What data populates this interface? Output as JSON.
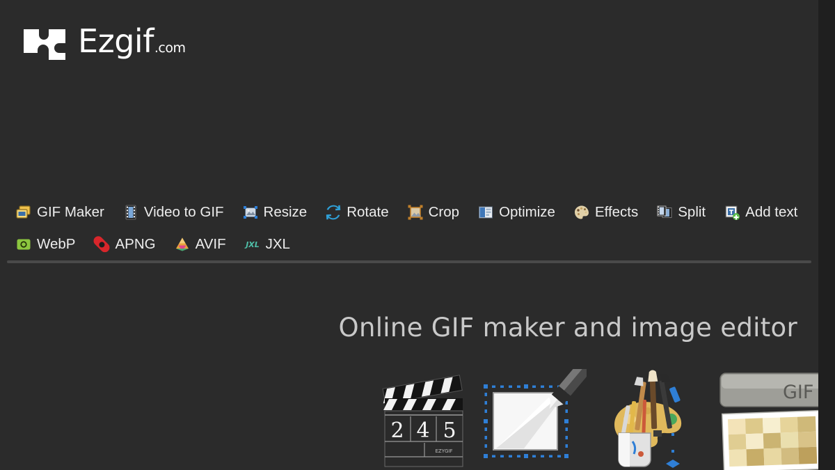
{
  "site": {
    "logo_text": "Ezgif",
    "logo_tld": ".com",
    "logo_icon": "ezgif-puzzle-logo-icon",
    "background_color": "#2b2b2b",
    "gutter_color": "#1f1f1f"
  },
  "nav": {
    "rows": [
      [
        {
          "label": "GIF Maker",
          "icon": "gif-maker-icon"
        },
        {
          "label": "Video to GIF",
          "icon": "video-to-gif-icon"
        },
        {
          "label": "Resize",
          "icon": "resize-icon"
        },
        {
          "label": "Rotate",
          "icon": "rotate-icon"
        },
        {
          "label": "Crop",
          "icon": "crop-icon"
        },
        {
          "label": "Optimize",
          "icon": "optimize-icon"
        },
        {
          "label": "Effects",
          "icon": "effects-palette-icon"
        },
        {
          "label": "Split",
          "icon": "split-icon"
        },
        {
          "label": "Add text",
          "icon": "add-text-icon"
        }
      ],
      [
        {
          "label": "WebP",
          "icon": "webp-icon"
        },
        {
          "label": "APNG",
          "icon": "apng-icon"
        },
        {
          "label": "AVIF",
          "icon": "avif-icon"
        },
        {
          "label": "JXL",
          "icon": "jxl-icon"
        }
      ]
    ]
  },
  "main": {
    "title": "Online GIF maker and image editor",
    "illustrations": [
      {
        "name": "clapperboard-illustration",
        "numbers": "2 4 5",
        "sublabel": "EZYGIF"
      },
      {
        "name": "image-editor-pen-illustration"
      },
      {
        "name": "paint-palette-brushes-illustration"
      },
      {
        "name": "gif-frames-stack-illustration",
        "label": "GIF"
      }
    ]
  },
  "colors": {
    "accent_blue": "#3b8fd8",
    "webp_green": "#8cc63f",
    "apng_red": "#d8262b",
    "avif_orange": "#e8a33d",
    "jxl_teal": "#4fbfa8",
    "text": "#ededed",
    "title_text": "#c9c9c9",
    "divider": "#4a4a4a"
  }
}
